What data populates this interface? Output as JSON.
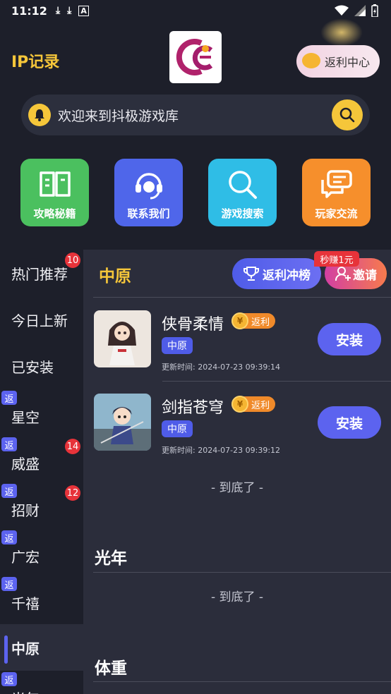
{
  "status": {
    "time": "11:12"
  },
  "header": {
    "title": "IP记录",
    "rebate_center": "返利中心"
  },
  "search": {
    "placeholder": "欢迎来到抖极游戏库"
  },
  "quick_actions": [
    {
      "label": "攻略秘籍",
      "icon": "book-icon",
      "color": "#4bc05f"
    },
    {
      "label": "联系我们",
      "icon": "headset-icon",
      "color": "#4f66ea"
    },
    {
      "label": "游戏搜索",
      "icon": "search-icon",
      "color": "#2fbde6"
    },
    {
      "label": "玩家交流",
      "icon": "chat-icon",
      "color": "#f68f2c"
    }
  ],
  "sidebar": {
    "fan_tag": "返",
    "items": [
      {
        "label": "热门推荐",
        "badge": "10"
      },
      {
        "label": "今日上新"
      },
      {
        "label": "已安装"
      },
      {
        "label": "星空"
      },
      {
        "label": "威盛",
        "badge": "14"
      },
      {
        "label": "招财",
        "badge": "12"
      },
      {
        "label": "广宏"
      },
      {
        "label": "千禧"
      },
      {
        "label": "中原"
      },
      {
        "label": "光年"
      }
    ]
  },
  "content": {
    "section_title": "中原",
    "rank_button": "返利冲榜",
    "invite_button": "邀请",
    "earn_tag": "秒赚1元",
    "games": [
      {
        "name": "侠骨柔情",
        "fan": "返利",
        "region": "中原",
        "updated": "更新时间: 2024-07-23 09:39:14",
        "install": "安装"
      },
      {
        "name": "剑指苍穹",
        "fan": "返利",
        "region": "中原",
        "updated": "更新时间: 2024-07-23 09:39:12",
        "install": "安装"
      }
    ],
    "end_text": "- 到底了 -",
    "sections": [
      {
        "title": "光年",
        "end_text": "- 到底了 -"
      },
      {
        "title": "体重"
      }
    ]
  }
}
